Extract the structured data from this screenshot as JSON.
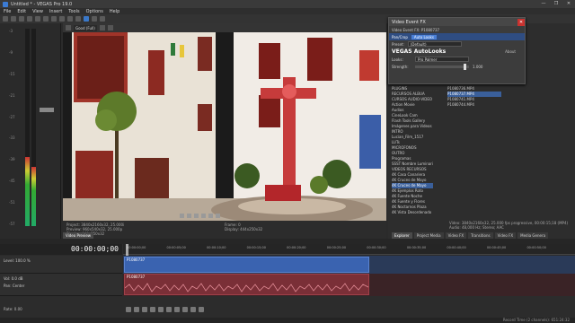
{
  "window": {
    "title": "Untitled * - VEGAS Pro 19.0",
    "controls": [
      "—",
      "❐",
      "✕"
    ]
  },
  "menu": [
    "File",
    "Edit",
    "View",
    "Insert",
    "Tools",
    "Options",
    "Help"
  ],
  "preview": {
    "mode_label": "Good (Full)",
    "info_left": [
      "Project: 3840x2160x32, 25.000i",
      "Preview: 960x540x32, 25.000p",
      "Display: 444x250x32"
    ],
    "info_right": [
      "Frame:  0",
      "Display: 444x250x32"
    ],
    "tab_label": "Video Preview"
  },
  "fx_window": {
    "title": "Video Event FX",
    "chain_label": "Video Event FX: P1080737",
    "pan_crop": "Pan/Crop",
    "plugin_label": "Auto Looks",
    "preset_label": "Preset:",
    "preset_value": "(Default)",
    "heading": "VEGAS AutoLooks",
    "about_label": "About",
    "looks_label": "Looks:",
    "looks_value": "Pro Palmer",
    "strength_label": "Strength:",
    "strength_value": "1.000",
    "strength_fraction": 0.95
  },
  "explorer": {
    "tree": [
      "PLUGINS",
      "RECURSOS ALBUA",
      "CURSOS AUDIO-VIDEO",
      "Action Movie",
      "Audios",
      "CineLook Cam",
      "Flash Tools Gallery",
      "Imágenes para Videos",
      "INTRO",
      "Lucian_Film_1517",
      "LUTs",
      "MICROFONOS",
      "OUTRO",
      "Programas",
      "SSST Nombre Luminari",
      "VIDEOS RECURSOS",
      "4K Casa Canariera",
      "4K Cruces de Mayo",
      "4K Cruces de Mayo",
      "4K Ejemplos Roto",
      "4K Fuente Noche",
      "4K Fuente y Flores",
      "4K Noctarnos Plaza",
      "4K Vista Desordenado"
    ],
    "selected_tree_index": 18,
    "files": [
      "P1080736.MP4",
      "P1080737.MP4",
      "P1080741.MP4",
      "P1080744.MP4"
    ],
    "selected_file_index": 1,
    "info": [
      "Video: 3840x2160x32, 25.000 fps progressive, 00:00:15;18 (MP4)",
      "Audio: 48,000 Hz; Stereo; AAC"
    ]
  },
  "left_tabs": [
    "Explorer",
    "Project Media",
    "Video FX",
    "Transitions",
    "Video FX",
    "Media Genera"
  ],
  "timeline": {
    "timecode": "00:00:00;00",
    "ruler_ticks": [
      "00:00:00;00",
      "00:00:05;00",
      "00:00:10;00",
      "00:00:15;00",
      "00:00:20;00",
      "00:00:25;00",
      "00:00:30;00",
      "00:00:35;00",
      "00:00:40;00",
      "00:00:45;00",
      "00:00:50;00"
    ],
    "video_track": {
      "level_label": "Level: 100.0 %",
      "clip_name": "P1080737"
    },
    "audio_track": {
      "vol_label": "Vol:  0.0 dB",
      "pan_label": "Pan:  Center",
      "clip_name": "P1080737"
    },
    "rate_label": "Rate: 0.00"
  },
  "status": {
    "record_time": "Record Time (2 channels): 651:24:32"
  },
  "colors": {
    "accent": "#3a78c8",
    "video_clip": "#3a63b0",
    "audio_clip": "#7a2f37",
    "close": "#c8322f"
  }
}
